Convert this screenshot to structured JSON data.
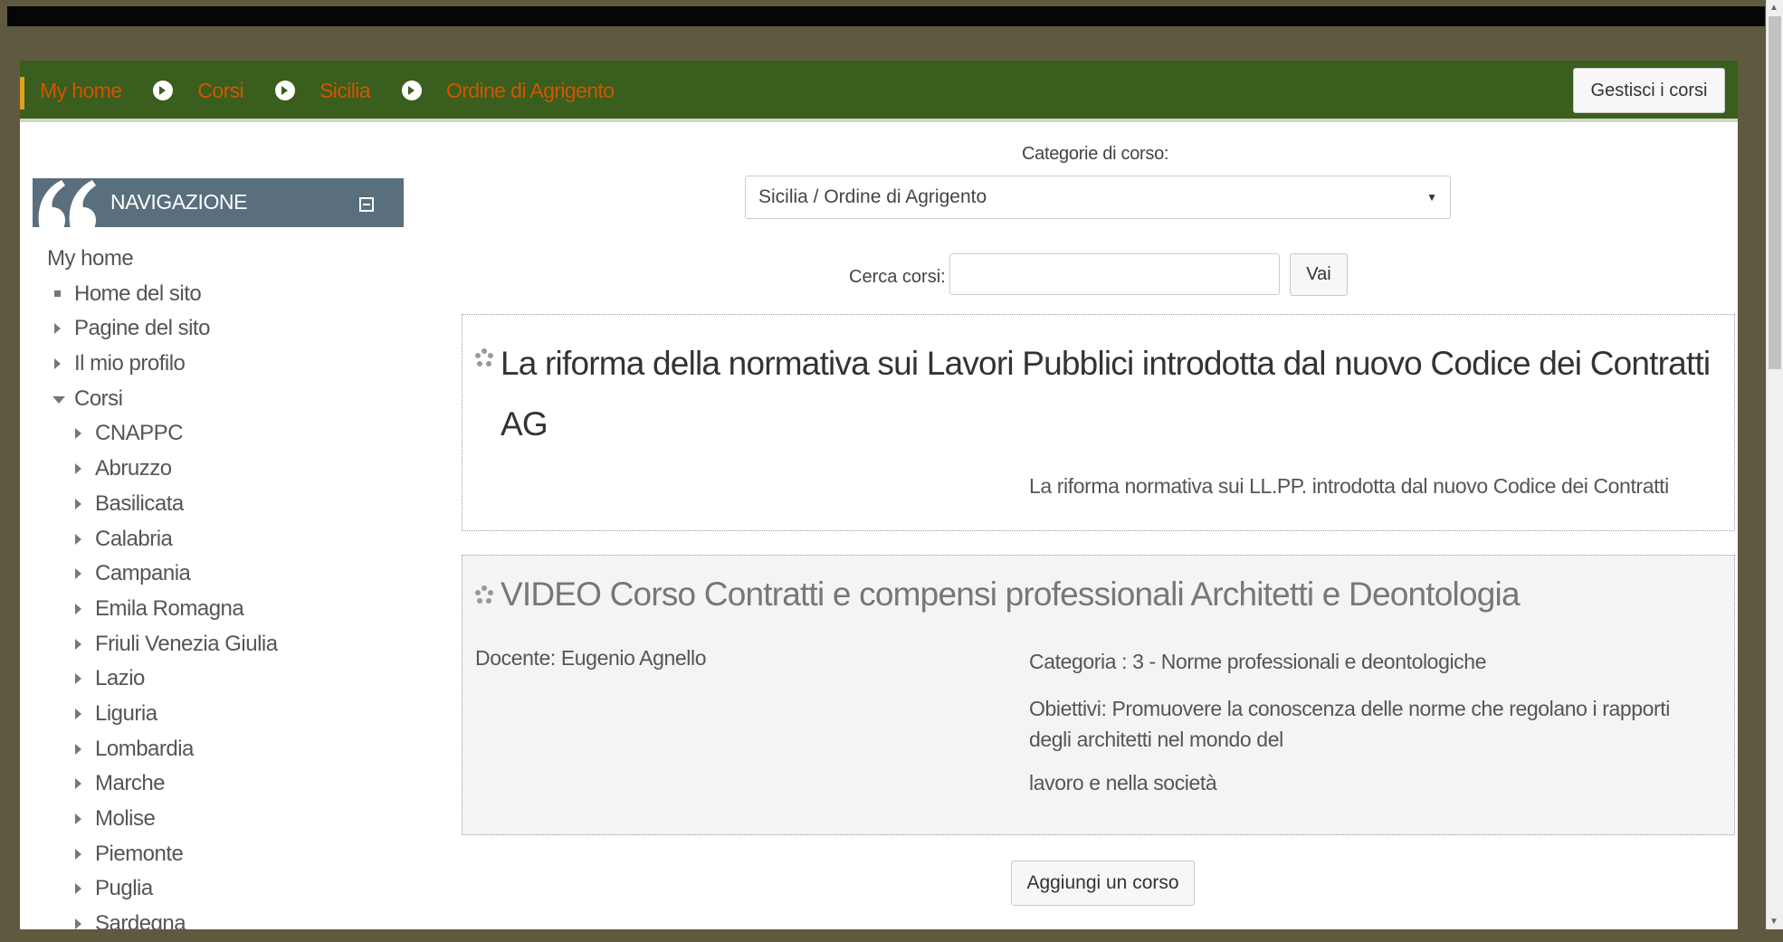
{
  "breadcrumb": {
    "items": [
      "My home",
      "Corsi",
      "Sicilia",
      "Ordine di Agrigento"
    ]
  },
  "header": {
    "manage_courses_label": "Gestisci i corsi"
  },
  "sidebar": {
    "title": "NAVIGAZIONE",
    "items": [
      {
        "label": "My home",
        "type": "root"
      },
      {
        "label": "Home del sito",
        "type": "leaf"
      },
      {
        "label": "Pagine del sito",
        "type": "collapsed"
      },
      {
        "label": "Il mio profilo",
        "type": "collapsed"
      },
      {
        "label": "Corsi",
        "type": "expanded"
      },
      {
        "label": "CNAPPC",
        "type": "child"
      },
      {
        "label": "Abruzzo",
        "type": "child"
      },
      {
        "label": "Basilicata",
        "type": "child"
      },
      {
        "label": "Calabria",
        "type": "child"
      },
      {
        "label": "Campania",
        "type": "child"
      },
      {
        "label": "Emila Romagna",
        "type": "child"
      },
      {
        "label": "Friuli Venezia Giulia",
        "type": "child"
      },
      {
        "label": "Lazio",
        "type": "child"
      },
      {
        "label": "Liguria",
        "type": "child"
      },
      {
        "label": "Lombardia",
        "type": "child"
      },
      {
        "label": "Marche",
        "type": "child"
      },
      {
        "label": "Molise",
        "type": "child"
      },
      {
        "label": "Piemonte",
        "type": "child"
      },
      {
        "label": "Puglia",
        "type": "child"
      },
      {
        "label": "Sardegna",
        "type": "child"
      }
    ]
  },
  "category": {
    "label": "Categorie di corso:",
    "selected": "Sicilia / Ordine di Agrigento"
  },
  "search": {
    "label": "Cerca corsi:",
    "value": "",
    "button": "Vai"
  },
  "courses": [
    {
      "title": "La riforma della normativa sui Lavori Pubblici introdotta dal nuovo Codice dei Contratti AG",
      "summary": "La riforma  normativa sui LL.PP. introdotta dal nuovo Codice dei Contratti"
    },
    {
      "title": "VIDEO Corso Contratti e compensi professionali Architetti e Deontologia",
      "teacher": "Docente: Eugenio Agnello",
      "category": "Categoria : 3 - Norme professionali e deontologiche",
      "objectives": "Obiettivi: Promuovere la conoscenza delle norme che regolano i rapporti degli architetti nel mondo del",
      "objectives_cont": "lavoro e nella società"
    }
  ],
  "add_course_label": "Aggiungi un corso",
  "colors": {
    "navbar": "#3a5e1d",
    "breadcrumb_link": "#d35400",
    "sidebar_header": "#5a6f7d",
    "outer_background": "#5f5a3f"
  }
}
